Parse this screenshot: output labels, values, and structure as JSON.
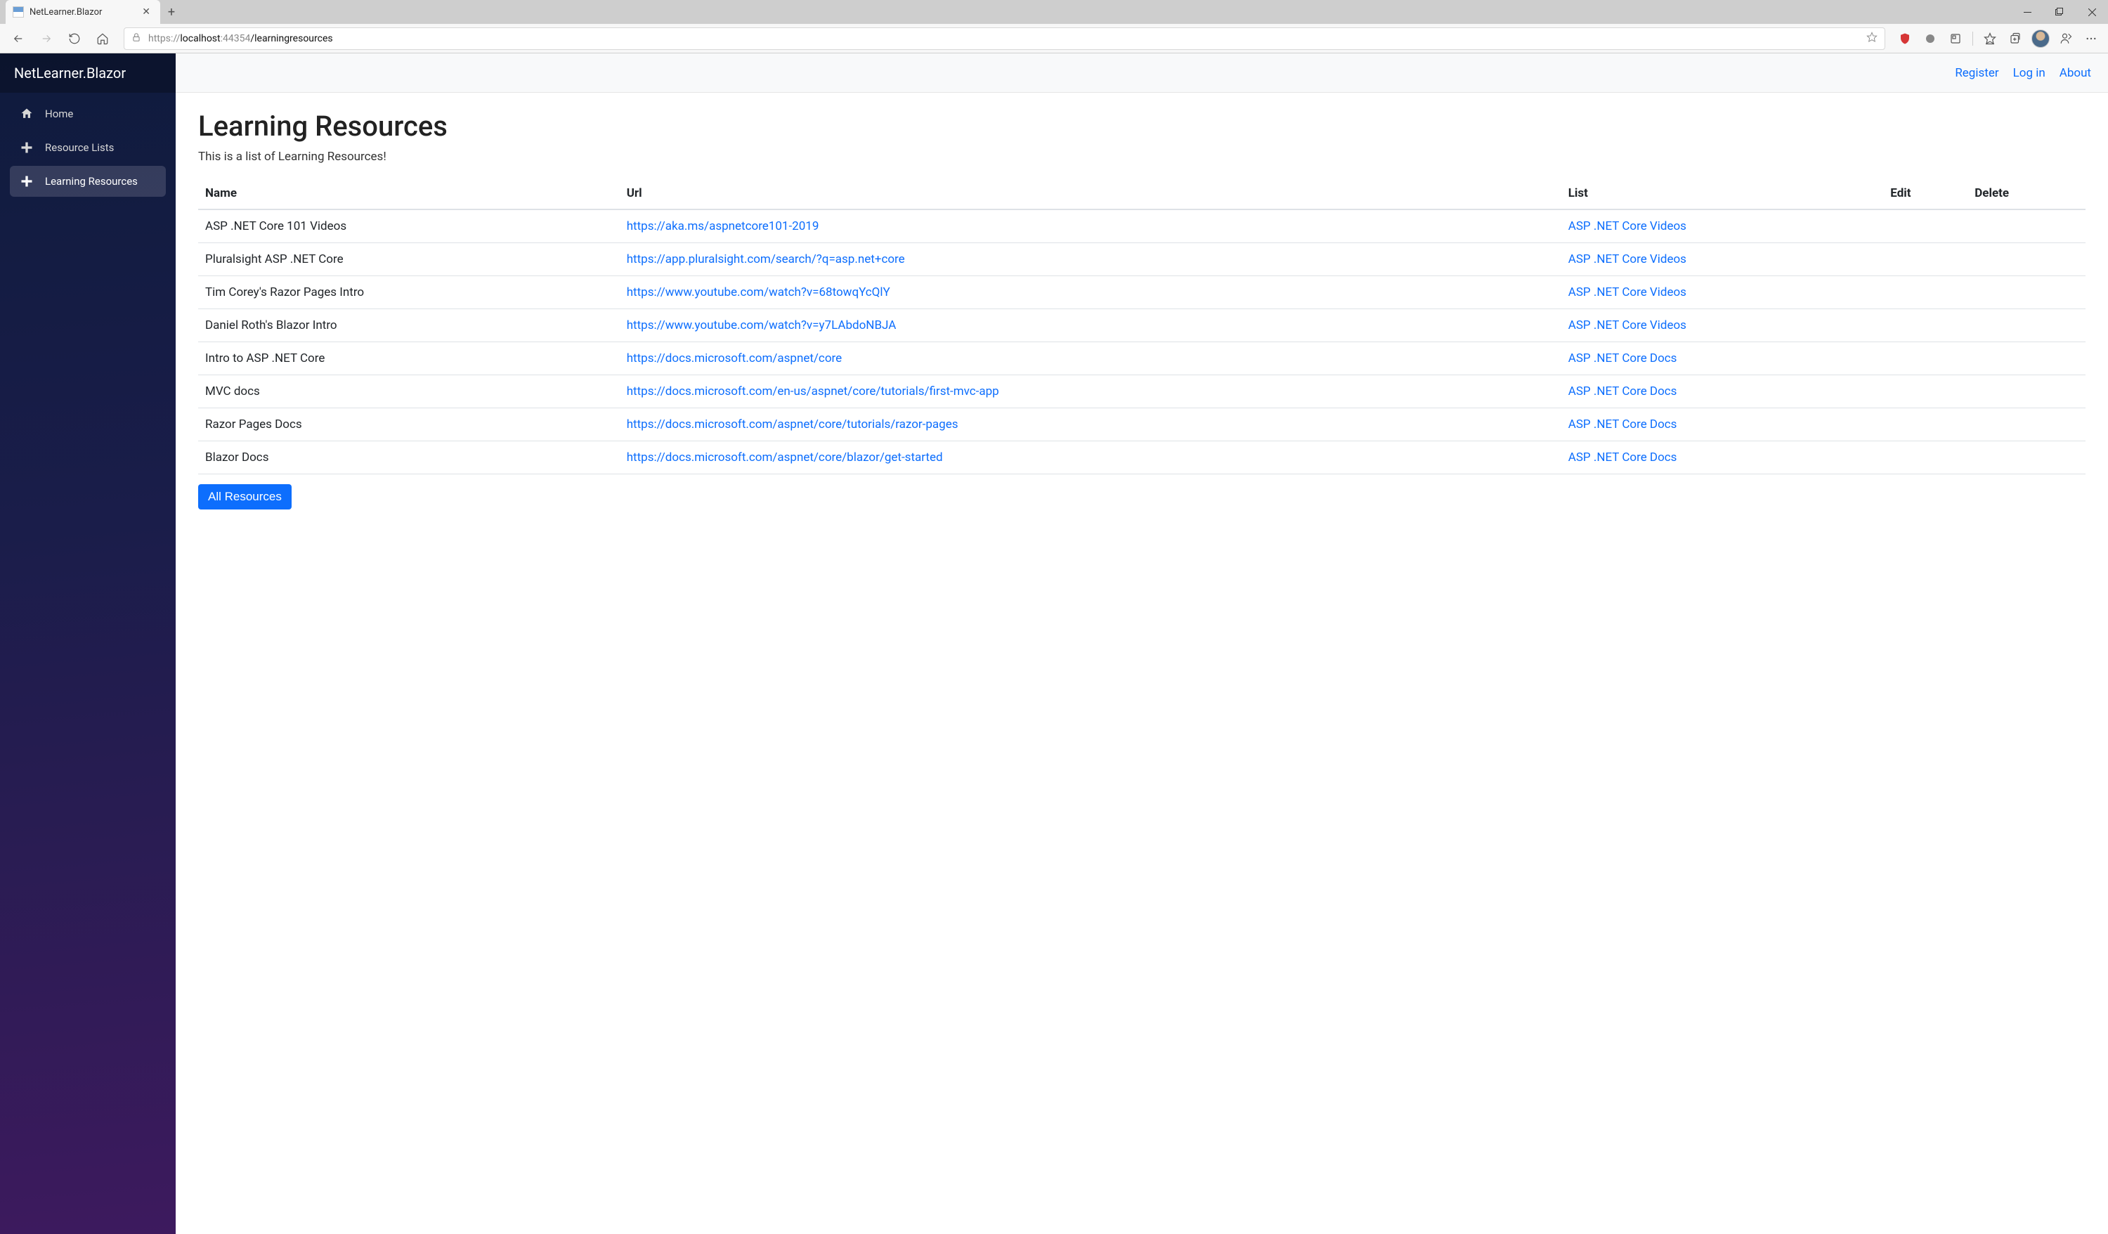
{
  "browser": {
    "tab_title": "NetLearner.Blazor",
    "url_prefix": "https://",
    "url_host": "localhost",
    "url_port": ":44354",
    "url_path": "/learningresources"
  },
  "sidebar": {
    "brand": "NetLearner.Blazor",
    "items": [
      {
        "label": "Home",
        "icon": "home"
      },
      {
        "label": "Resource Lists",
        "icon": "plus"
      },
      {
        "label": "Learning Resources",
        "icon": "plus"
      }
    ]
  },
  "topbar": {
    "register": "Register",
    "login": "Log in",
    "about": "About"
  },
  "page": {
    "title": "Learning Resources",
    "subtitle": "This is a list of Learning Resources!",
    "columns": {
      "name": "Name",
      "url": "Url",
      "list": "List",
      "edit": "Edit",
      "delete": "Delete"
    },
    "rows": [
      {
        "name": "ASP .NET Core 101 Videos",
        "url": "https://aka.ms/aspnetcore101-2019",
        "list": "ASP .NET Core Videos"
      },
      {
        "name": "Pluralsight ASP .NET Core",
        "url": "https://app.pluralsight.com/search/?q=asp.net+core",
        "list": "ASP .NET Core Videos"
      },
      {
        "name": "Tim Corey's Razor Pages Intro",
        "url": "https://www.youtube.com/watch?v=68towqYcQlY",
        "list": "ASP .NET Core Videos"
      },
      {
        "name": "Daniel Roth's Blazor Intro",
        "url": "https://www.youtube.com/watch?v=y7LAbdoNBJA",
        "list": "ASP .NET Core Videos"
      },
      {
        "name": "Intro to ASP .NET Core",
        "url": "https://docs.microsoft.com/aspnet/core",
        "list": "ASP .NET Core Docs"
      },
      {
        "name": "MVC docs",
        "url": "https://docs.microsoft.com/en-us/aspnet/core/tutorials/first-mvc-app",
        "list": "ASP .NET Core Docs"
      },
      {
        "name": "Razor Pages Docs",
        "url": "https://docs.microsoft.com/aspnet/core/tutorials/razor-pages",
        "list": "ASP .NET Core Docs"
      },
      {
        "name": "Blazor Docs",
        "url": "https://docs.microsoft.com/aspnet/core/blazor/get-started",
        "list": "ASP .NET Core Docs"
      }
    ],
    "all_button": "All Resources"
  }
}
